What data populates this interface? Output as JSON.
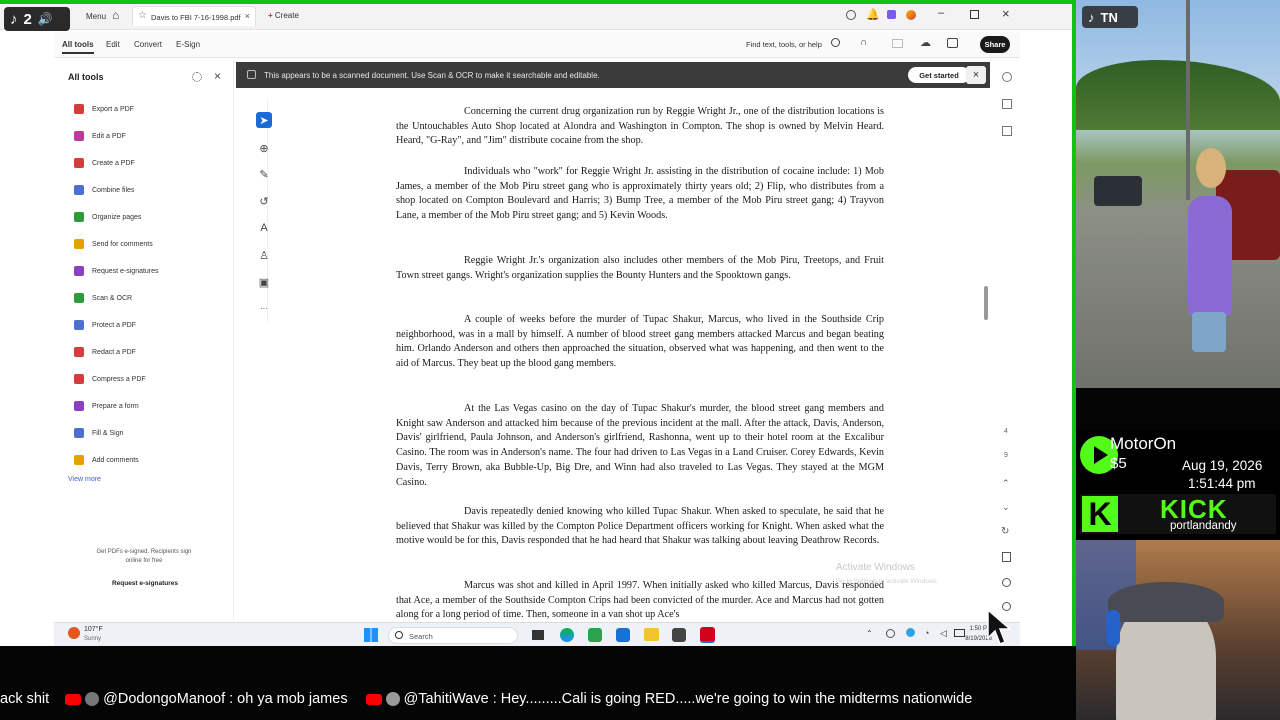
{
  "tiktok_left": {
    "count": "2"
  },
  "window": {
    "menu_label": "Menu",
    "tab_title": "Davis to FBI 7-16-1998.pdf",
    "new_tab_label": "Create"
  },
  "toolbar": {
    "tabs": [
      "All tools",
      "Edit",
      "Convert",
      "E-Sign"
    ],
    "find_label": "Find text, tools, or help",
    "share_label": "Share"
  },
  "sidepanel": {
    "title": "All tools",
    "items": [
      {
        "label": "Export a PDF",
        "color": "#d83b3b"
      },
      {
        "label": "Edit a PDF",
        "color": "#c0399a"
      },
      {
        "label": "Create a PDF",
        "color": "#d83b3b"
      },
      {
        "label": "Combine files",
        "color": "#4c6fd1"
      },
      {
        "label": "Organize pages",
        "color": "#2f9c3b"
      },
      {
        "label": "Send for comments",
        "color": "#e8a000"
      },
      {
        "label": "Request e-signatures",
        "color": "#8b3fc3"
      },
      {
        "label": "Scan & OCR",
        "color": "#2f9c3b"
      },
      {
        "label": "Protect a PDF",
        "color": "#4c6fd1"
      },
      {
        "label": "Redact a PDF",
        "color": "#d83b3b"
      },
      {
        "label": "Compress a PDF",
        "color": "#d83b3b"
      },
      {
        "label": "Prepare a form",
        "color": "#8b3fc3"
      },
      {
        "label": "Fill & Sign",
        "color": "#4c6fd1"
      },
      {
        "label": "Add comments",
        "color": "#e8a000"
      }
    ],
    "view_more": "View more",
    "promo_line1": "Get PDFs e-signed. Recipients sign",
    "promo_line2": "online for free",
    "promo_button": "Request e-signatures"
  },
  "banner": {
    "message": "This appears to be a scanned document. Use Scan & OCR to make it searchable and editable.",
    "button": "Get started"
  },
  "document": {
    "paragraphs": [
      "Concerning the current drug organization run by Reggie Wright Jr., one of the distribution locations is the Untouchables Auto Shop located at Alondra and Washington in Compton. The shop is owned by Melvin Heard. Heard, \"G-Ray\", and \"Jim\" distribute cocaine from the shop.",
      "Individuals who \"work\" for Reggie Wright Jr. assisting in the distribution of cocaine include: 1) Mob James, a member of the Mob Piru street gang who is approximately thirty years old; 2) Flip, who distributes from a shop located on Compton Boulevard and Harris; 3) Bump Tree, a member of the Mob Piru street gang; 4) Trayvon Lane, a member of the Mob Piru street gang; and 5) Kevin Woods.",
      "Reggie Wright Jr.'s organization also includes other members of the Mob Piru, Treetops, and Fruit Town street gangs. Wright's organization supplies the Bounty Hunters and the Spooktown gangs.",
      "A couple of weeks before the murder of Tupac Shakur, Marcus, who lived in the Southside Crip neighborhood, was in a mall by himself. A number of blood street gang members attacked Marcus and began beating him. Orlando Anderson and others then approached the situation, observed what was happening, and then went to the aid of Marcus. They beat up the blood gang members.",
      "At the Las Vegas casino on the day of Tupac Shakur's murder, the blood street gang members and Knight saw Anderson and attacked him because of the previous incident at the mall. After the attack, Davis, Anderson, Davis' girlfriend, Paula Johnson, and Anderson's girlfriend, Rashonna, went up to their hotel room at the Excalibur Casino. The room was in Anderson's name. The four had driven to Las Vegas in a Land Cruiser. Corey Edwards, Kevin Davis, Terry Brown, aka Bubble-Up, Big Dre, and Winn had also traveled to Las Vegas. They stayed at the MGM Casino.",
      "Davis repeatedly denied knowing who killed Tupac Shakur. When asked to speculate, he said that he believed that Shakur was killed by the Compton Police Department officers working for Knight. When asked what the motive would be for this, Davis responded that he had heard that Shakur was talking about leaving Deathrow Records.",
      "Marcus was shot and killed in April 1997. When initially asked who killed Marcus, Davis responded that Ace, a member of the Southside Compton Crips had been convicted of the murder. Ace and Marcus had not gotten along for a long period of time. Then, someone in a van shot up Ace's"
    ],
    "watermark_line1": "Activate Windows",
    "watermark_line2": "Go to Settings to activate Windows."
  },
  "taskbar": {
    "weather_temp": "107°F",
    "weather_desc": "Sunny",
    "search_label": "Search",
    "clock_time": "1:50 PM",
    "clock_date": "8/19/2026"
  },
  "overlay": {
    "tiktok_label": "TN",
    "donor_name": "MotorOn",
    "donation_amount": "$5",
    "date": "Aug 19, 2026",
    "time": "1:51:44 pm",
    "kick_label": "KICK",
    "kick_user": "portlandandy"
  },
  "chat": {
    "partial_message": "ack shit",
    "messages": [
      {
        "user": "@DodongoManoof",
        "text": "oh ya mob james"
      },
      {
        "user": "@TahitiWave",
        "text": "Hey.........Cali is going RED.....we're going to win the midterms nationwide"
      }
    ]
  },
  "colors": {
    "stream_border": "#12c212",
    "kick_green": "#53fc18",
    "youtube_red": "#ff0000"
  }
}
